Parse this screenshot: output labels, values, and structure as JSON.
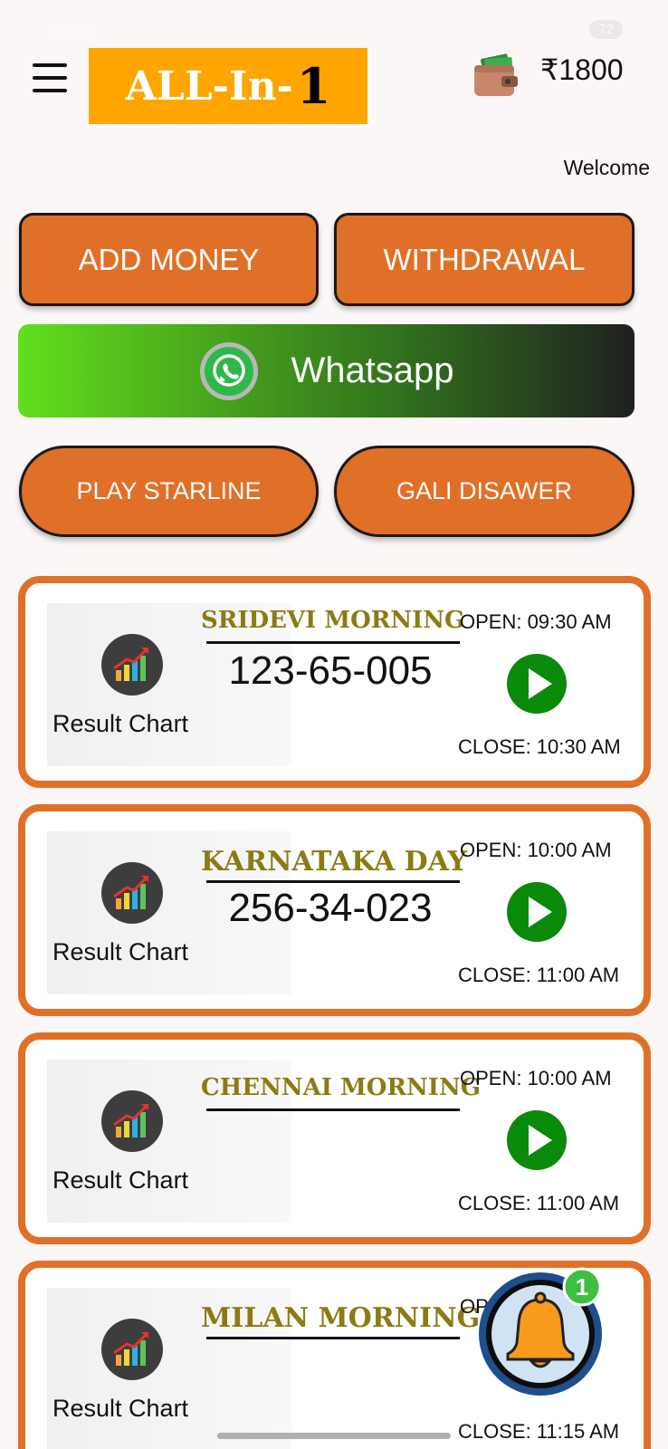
{
  "status_bar": {
    "time": "11:16",
    "battery": "72"
  },
  "header": {
    "logo_text": "ALL-In-",
    "logo_number": "1",
    "wallet_icon": "wallet-icon",
    "balance": "₹1800"
  },
  "welcome_text": "Welcome",
  "actions": {
    "add_money": "ADD MONEY",
    "withdrawal": "WITHDRAWAL",
    "whatsapp": "Whatsapp",
    "play_starline": "PLAY STARLINE",
    "gali_disawer": "GALI DISAWER"
  },
  "colors": {
    "accent_orange": "#e07027",
    "logo_yellow": "#ffa500",
    "market_name_gold": "#8b7b14",
    "play_green": "#0a8a0a"
  },
  "markets": [
    {
      "name": "SRIDEVI MORNING",
      "result": "123-65-005",
      "open": "OPEN: 09:30 AM",
      "close": "CLOSE: 10:30 AM",
      "chart_label": "Result Chart"
    },
    {
      "name": "KARNATAKA DAY",
      "result": "256-34-023",
      "open": "OPEN: 10:00 AM",
      "close": "CLOSE: 11:00 AM",
      "chart_label": "Result Chart"
    },
    {
      "name": "CHENNAI MORNING",
      "result": "",
      "open": "OPEN: 10:00 AM",
      "close": "CLOSE: 11:00 AM",
      "chart_label": "Result Chart"
    },
    {
      "name": "MILAN MORNING",
      "result": "",
      "open": "OPEN",
      "close": "CLOSE: 11:15 AM",
      "chart_label": "Result Chart"
    }
  ],
  "notification": {
    "icon": "bell-icon",
    "count": "1"
  }
}
